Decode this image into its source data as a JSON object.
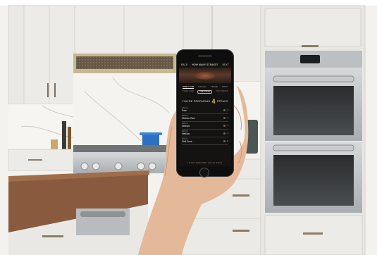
{
  "app": {
    "back_label": "BACK",
    "title": "HOW MANY STEAKS?",
    "next_label": "NEXT",
    "tabs": [
      "RIBEYE TBB",
      "SIRLOIN",
      "T-BONE",
      "STRIP"
    ],
    "active_tab_index": 0,
    "options": [
      "STEAK COOK",
      "ONE STEAK",
      "TWO STEAKS"
    ],
    "active_option_index": 1,
    "preparing_prefix": "YOU'RE PREPARING",
    "preparing_count": "4",
    "preparing_suffix": "STEAKS",
    "rows": [
      {
        "sub": "RIBEYE",
        "main": "Rare",
        "value": "1"
      },
      {
        "sub": "RIBEYE",
        "main": "Medium Rare",
        "value": "1"
      },
      {
        "sub": "RIBEYE",
        "main": "Medium",
        "value": "1"
      },
      {
        "sub": "RIBEYE",
        "main": "Medium",
        "value": "1"
      },
      {
        "sub": "RIBEYE",
        "main": "Well Done",
        "value": "0"
      }
    ],
    "footer": "I'M NOT SURE HOW I LIKE MY STEAK"
  },
  "colors": {
    "cabinet": "#ecebe7",
    "countertop": "#8a5a3e",
    "stainless": "#b9bcbe",
    "hood_trim": "#c9b894",
    "pan": "#2d6fc0"
  }
}
